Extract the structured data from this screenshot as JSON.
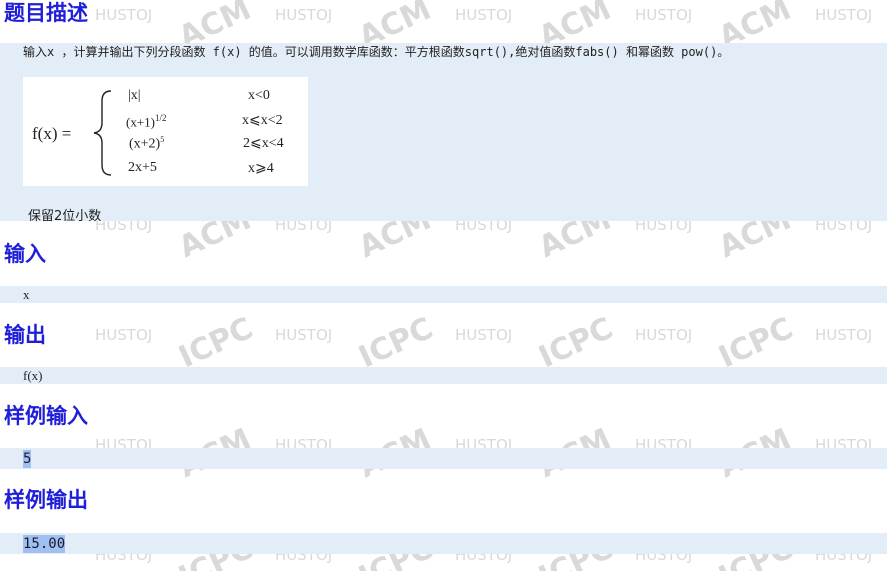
{
  "watermark": {
    "words": [
      "HUSTOJ",
      "ACM",
      "ICPC"
    ],
    "color": "#d9d9d9"
  },
  "problem": {
    "description": {
      "heading": "题目描述",
      "text": "输入x ，计算并输出下列分段函数 f(x) 的值。可以调用数学库函数：平方根函数sqrt(),绝对值函数fabs() 和幂函数 pow()。",
      "formula": {
        "lhs": "f(x) =",
        "cases": [
          {
            "expr": "|x|",
            "cond": "x<0"
          },
          {
            "expr": "(x+1)",
            "sup": "1/2",
            "cond": "x⩽x<2"
          },
          {
            "expr": "(x+2)",
            "sup": "5",
            "cond": "2⩽x<4"
          },
          {
            "expr": "2x+5",
            "cond": "x⩾4"
          }
        ]
      },
      "note": "保留2位小数"
    },
    "input": {
      "heading": "输入",
      "text": "x"
    },
    "output": {
      "heading": "输出",
      "text": "f(x)"
    },
    "sample_input": {
      "heading": "样例输入",
      "text": "5"
    },
    "sample_output": {
      "heading": "样例输出",
      "text": "15.00"
    }
  },
  "colors": {
    "heading": "#1f1fd9",
    "panel": "#e3edf7",
    "selection": "#9fc0f0"
  }
}
